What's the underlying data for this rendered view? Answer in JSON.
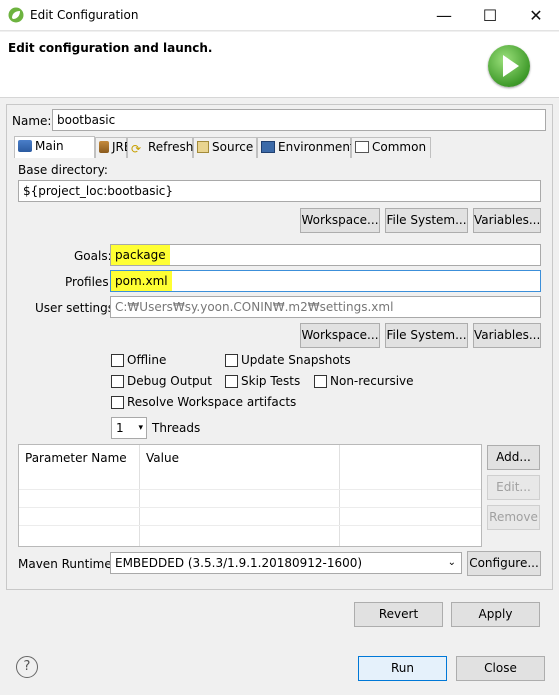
{
  "window": {
    "title": "Edit Configuration",
    "minimize": "—",
    "maximize": "☐",
    "close": "✕"
  },
  "header": {
    "heading": "Edit configuration and launch."
  },
  "name": {
    "label": "Name:",
    "value": "bootbasic"
  },
  "tabs": [
    "Main",
    "JRE",
    "Refresh",
    "Source",
    "Environment",
    "Common"
  ],
  "main": {
    "base_dir_label": "Base directory:",
    "base_dir_value": "${project_loc:bootbasic}",
    "workspace": "Workspace...",
    "file_system": "File System...",
    "variables": "Variables...",
    "goals_label": "Goals:",
    "goals_value": "package",
    "profiles_label": "Profiles:",
    "profiles_value": "pom.xml",
    "user_settings_label": "User settings:",
    "user_settings_value": "C:₩Users₩sy.yoon.CONIN₩.m2₩settings.xml",
    "offline": "Offline",
    "update_snapshots": "Update Snapshots",
    "debug_output": "Debug Output",
    "skip_tests": "Skip Tests",
    "non_recursive": "Non-recursive",
    "resolve_workspace": "Resolve Workspace artifacts",
    "threads_value": "1",
    "threads_label": "Threads",
    "param_col_name": "Parameter Name",
    "param_col_value": "Value",
    "add": "Add...",
    "edit": "Edit...",
    "remove": "Remove",
    "runtime_label": "Maven Runtime:",
    "runtime_value": "EMBEDDED (3.5.3/1.9.1.20180912-1600)",
    "configure": "Configure..."
  },
  "footer": {
    "revert": "Revert",
    "apply": "Apply",
    "help": "?",
    "run": "Run",
    "close": "Close"
  }
}
